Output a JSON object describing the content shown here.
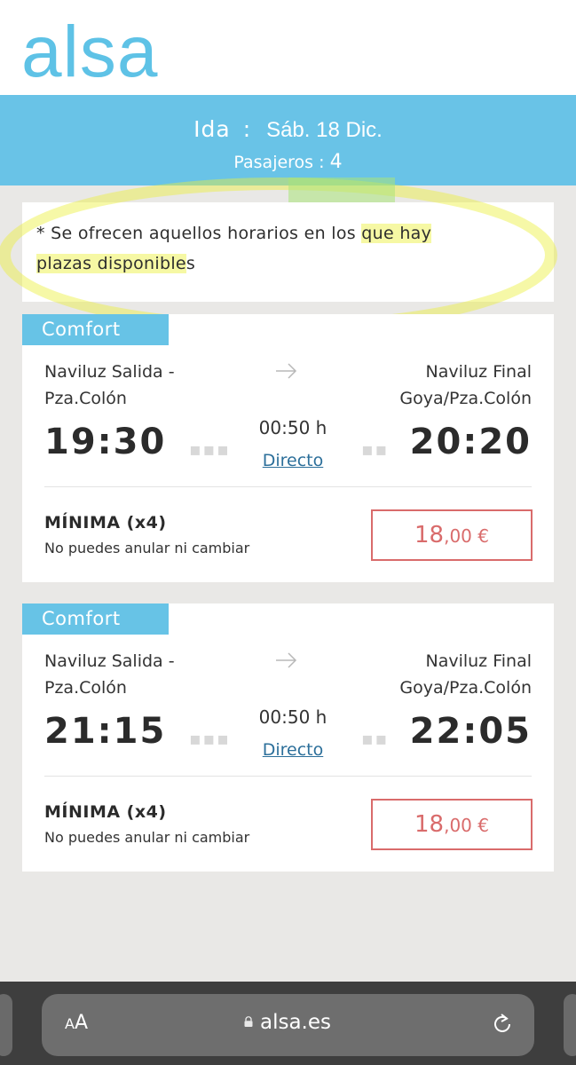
{
  "app": {
    "logo_text": "alsa"
  },
  "trip": {
    "direction_label": "Ida",
    "separator": ":",
    "date": "Sáb. 18 Dic.",
    "passengers_label": "Pasajeros",
    "passengers_count": "4"
  },
  "notice": {
    "text_before": "* Se ofrecen aquellos horarios en los ",
    "text_highlight_1": "que hay",
    "text_highlight_2": "plazas disponible",
    "text_after": "s"
  },
  "journeys": [
    {
      "badge": "Comfort",
      "from_line1": "Naviluz Salida -",
      "from_line2": "Pza.Colón",
      "to_line1": "Naviluz Final",
      "to_line2": "Goya/Pza.Colón",
      "departure": "19:30",
      "arrival": "20:20",
      "duration": "00:50 h",
      "type": "Directo",
      "fare_name": "MÍNIMA (x4)",
      "fare_conditions": "No puedes anular ni cambiar",
      "price_int": "18",
      "price_dec": ",00 €"
    },
    {
      "badge": "Comfort",
      "from_line1": "Naviluz Salida -",
      "from_line2": "Pza.Colón",
      "to_line1": "Naviluz Final",
      "to_line2": "Goya/Pza.Colón",
      "departure": "21:15",
      "arrival": "22:05",
      "duration": "00:50 h",
      "type": "Directo",
      "fare_name": "MÍNIMA (x4)",
      "fare_conditions": "No puedes anular ni cambiar",
      "price_int": "18",
      "price_dec": ",00 €"
    }
  ],
  "browser": {
    "text_size_small": "A",
    "text_size_large": "A",
    "url": "alsa.es",
    "icons": [
      "lock-icon",
      "reload-icon"
    ]
  },
  "colors": {
    "brand": "#5ec2e6",
    "header_band": "#69c3e7",
    "price_red": "#d96b6b",
    "link_blue": "#2c6f9a"
  }
}
